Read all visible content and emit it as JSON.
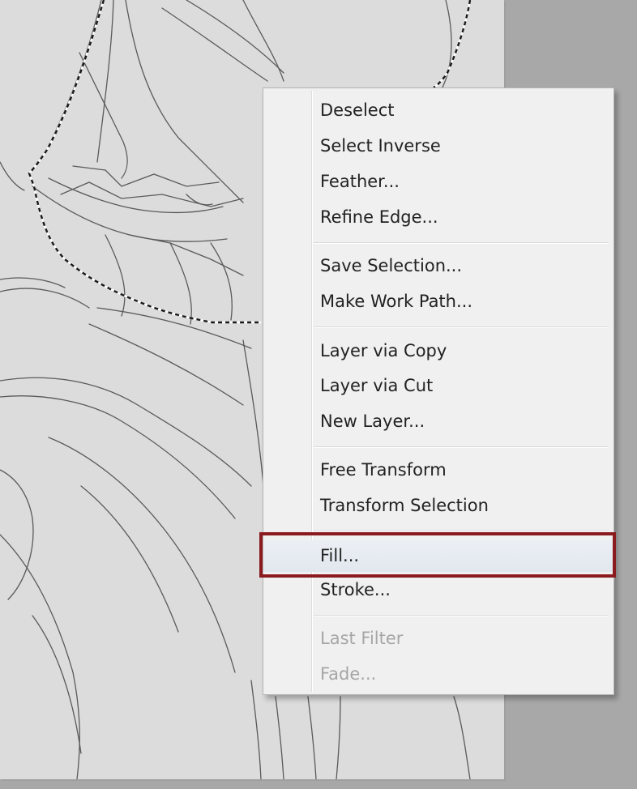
{
  "context_menu": {
    "items": [
      {
        "label": "Deselect",
        "enabled": true
      },
      {
        "label": "Select Inverse",
        "enabled": true
      },
      {
        "label": "Feather...",
        "enabled": true
      },
      {
        "label": "Refine Edge...",
        "enabled": true
      },
      {
        "label": "Save Selection...",
        "enabled": true
      },
      {
        "label": "Make Work Path...",
        "enabled": true
      },
      {
        "label": "Layer via Copy",
        "enabled": true
      },
      {
        "label": "Layer via Cut",
        "enabled": true
      },
      {
        "label": "New Layer...",
        "enabled": true
      },
      {
        "label": "Free Transform",
        "enabled": true
      },
      {
        "label": "Transform Selection",
        "enabled": true
      },
      {
        "label": "Fill...",
        "enabled": true,
        "highlighted": true
      },
      {
        "label": "Stroke...",
        "enabled": true
      },
      {
        "label": "Last Filter",
        "enabled": false
      },
      {
        "label": "Fade...",
        "enabled": false
      }
    ]
  },
  "colors": {
    "workspace_bg": "#a9a8a9",
    "document_bg": "#dcdcdc",
    "menu_bg": "#f0f0f0",
    "highlight_box": "#8b1a1f",
    "disabled_text": "#a6a6a6"
  }
}
